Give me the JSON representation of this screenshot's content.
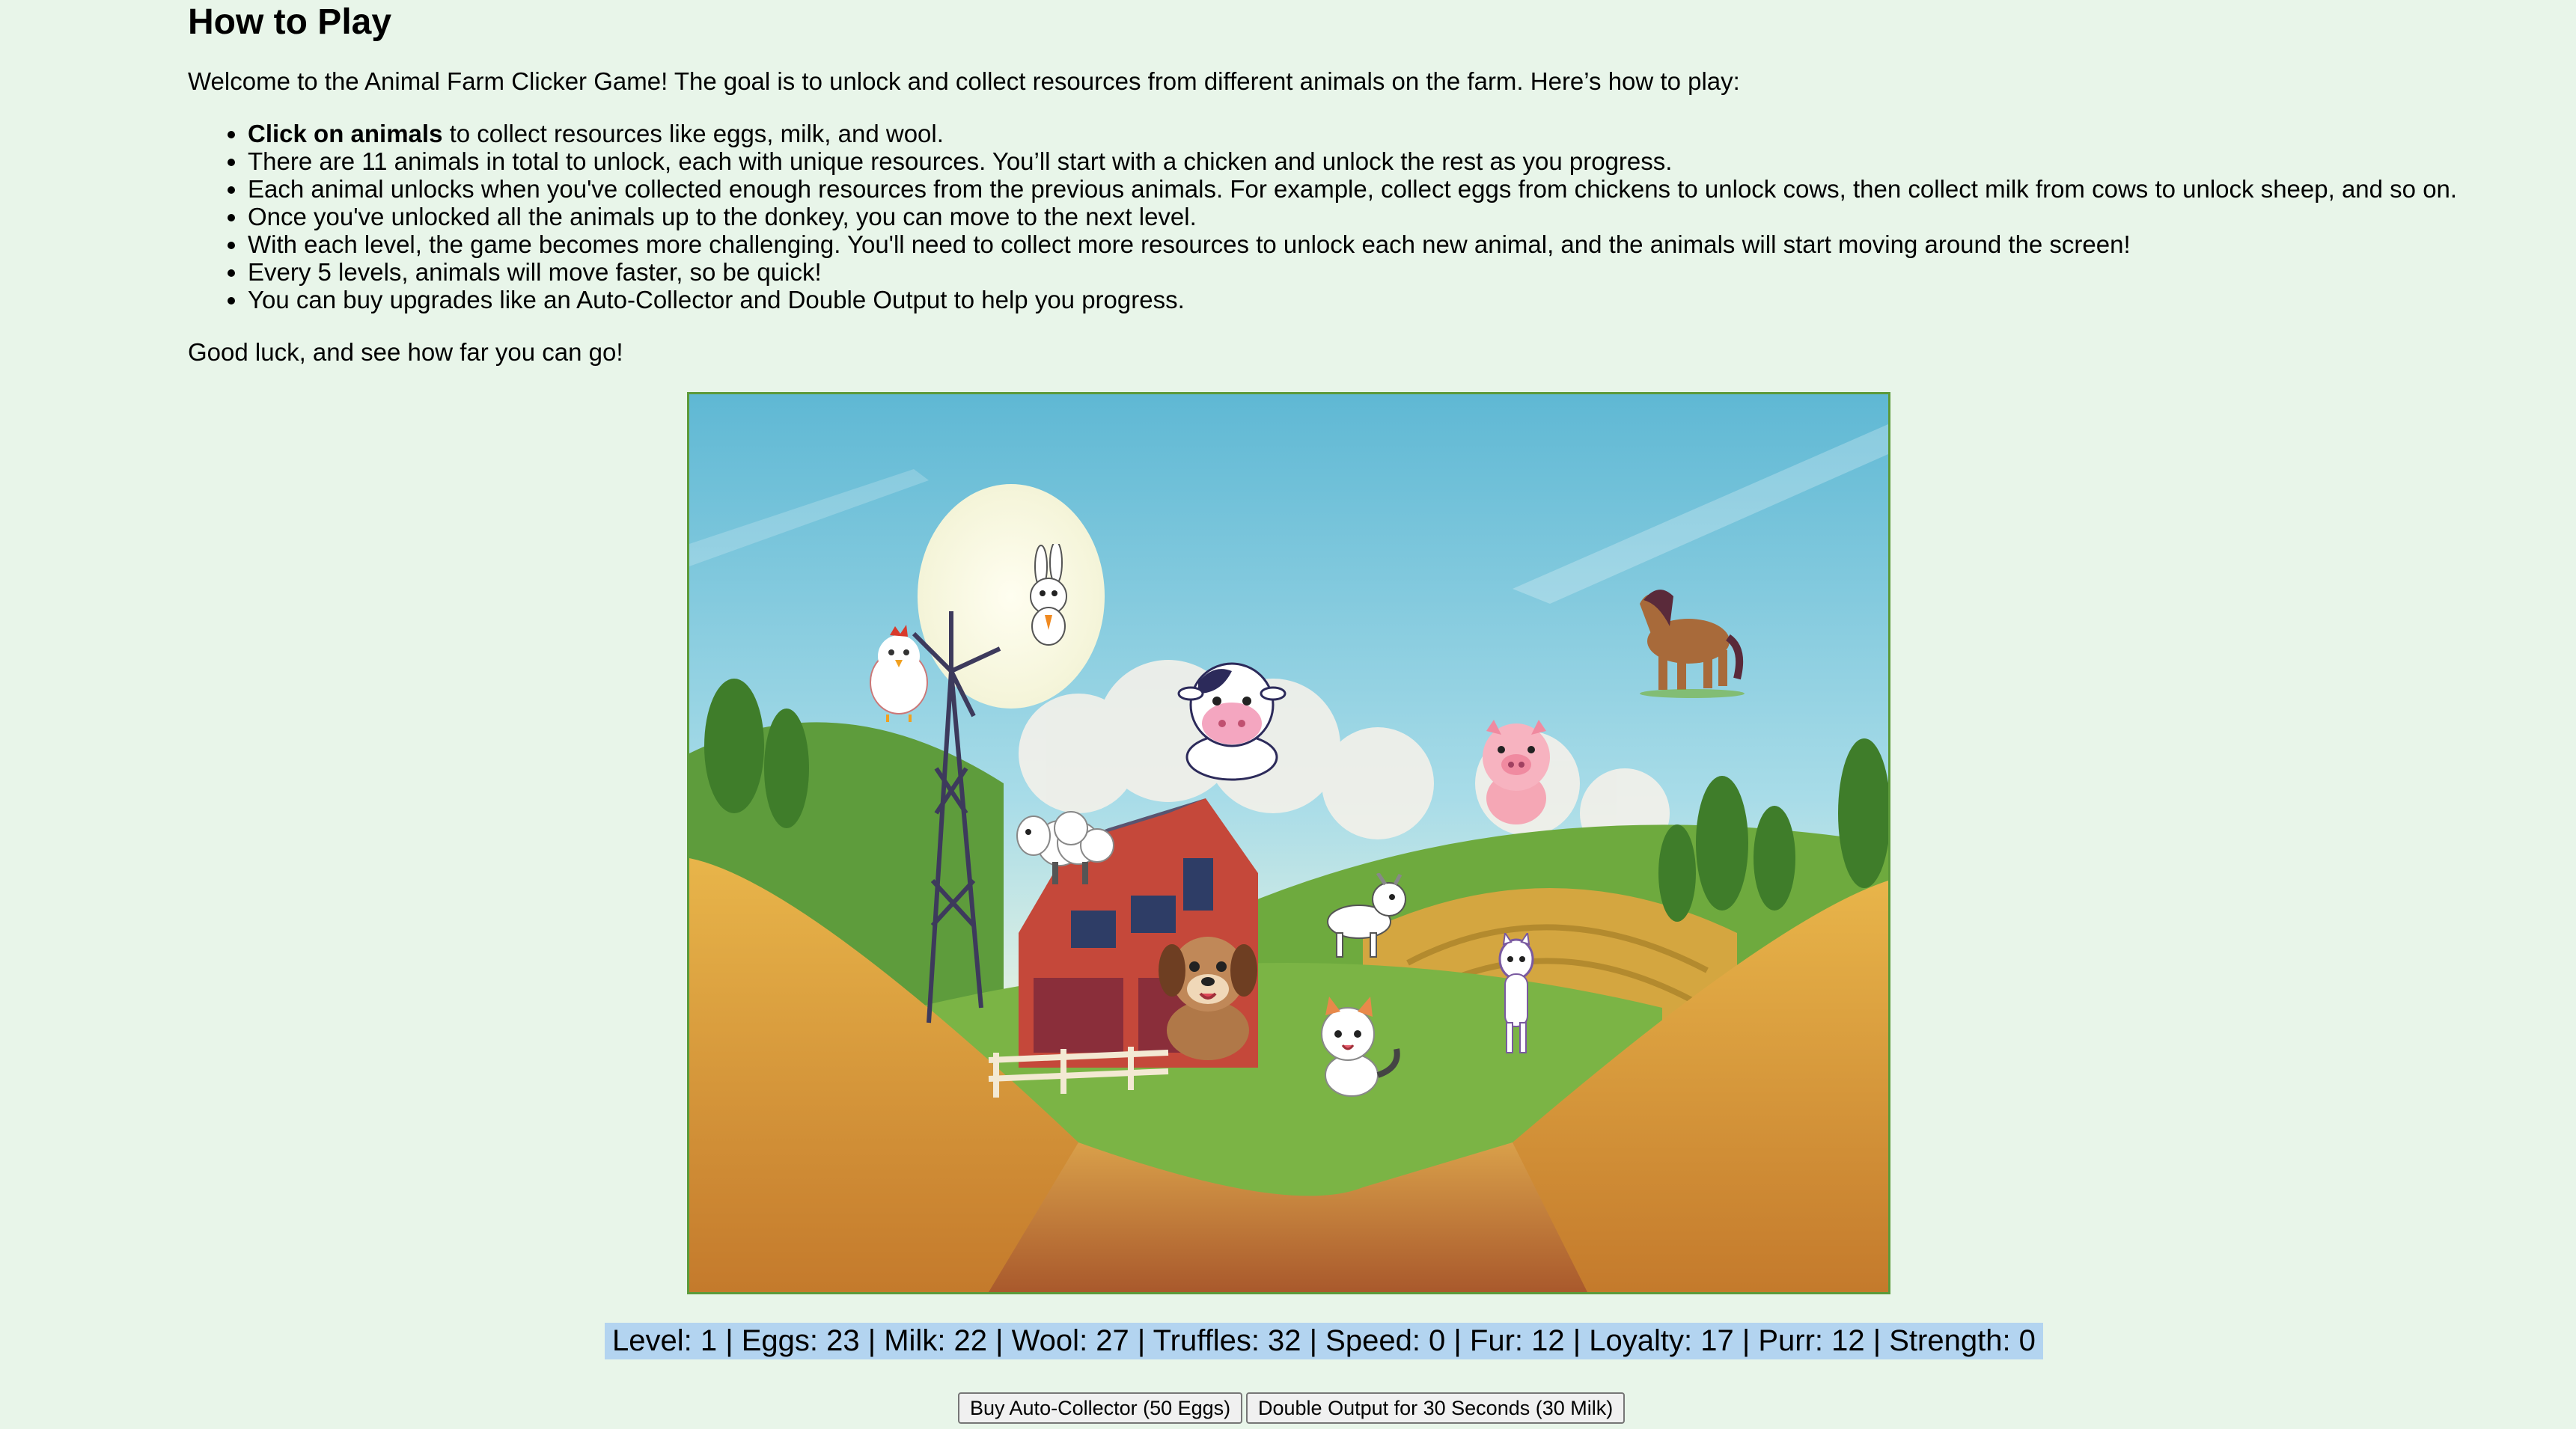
{
  "page": {
    "heading": "How to Play",
    "intro": "Welcome to the Animal Farm Clicker Game! The goal is to unlock and collect resources from different animals on the farm. Here’s how to play:",
    "rules": [
      {
        "bold": "Click on animals",
        "text": " to collect resources like eggs, milk, and wool."
      },
      {
        "bold": "",
        "text": "There are 11 animals in total to unlock, each with unique resources. You’ll start with a chicken and unlock the rest as you progress."
      },
      {
        "bold": "",
        "text": "Each animal unlocks when you've collected enough resources from the previous animals. For example, collect eggs from chickens to unlock cows, then collect milk from cows to unlock sheep, and so on."
      },
      {
        "bold": "",
        "text": "Once you've unlocked all the animals up to the donkey, you can move to the next level."
      },
      {
        "bold": "",
        "text": "With each level, the game becomes more challenging. You'll need to collect more resources to unlock each new animal, and the animals will start moving around the screen!"
      },
      {
        "bold": "",
        "text": "Every 5 levels, animals will move faster, so be quick!"
      },
      {
        "bold": "",
        "text": "You can buy upgrades like an Auto-Collector and Double Output to help you progress."
      }
    ],
    "outro": "Good luck, and see how far you can go!"
  },
  "game": {
    "animals": [
      "chicken-icon",
      "rabbit-icon",
      "cow-icon",
      "horse-icon",
      "pig-icon",
      "sheep-icon",
      "goat-icon",
      "dog-icon",
      "cat-icon",
      "alpaca-icon"
    ]
  },
  "stats": {
    "text": "Level: 1 | Eggs: 23 | Milk: 22 | Wool: 27 | Truffles: 32 | Speed: 0 | Fur: 12 | Loyalty: 17 | Purr: 12 | Strength: 0"
  },
  "buttons": {
    "auto_collector": "Buy Auto-Collector (50 Eggs)",
    "double_output": "Double Output for 30 Seconds (30 Milk)"
  },
  "colors": {
    "page_bg": "#e8f5e9",
    "game_border": "#5c9a3a",
    "stats_highlight": "#b3d4f0"
  }
}
